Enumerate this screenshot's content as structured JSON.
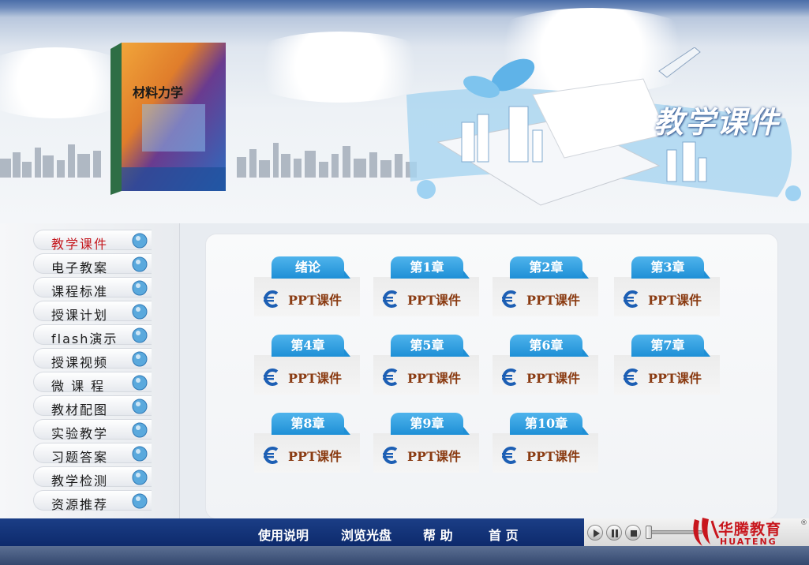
{
  "banner": {
    "title": "教学课件",
    "book_title": "材料力学"
  },
  "sidebar": {
    "items": [
      {
        "label": "教学课件",
        "icon": "projector-icon",
        "active": true
      },
      {
        "label": "电子教案",
        "icon": "info-icon",
        "active": false
      },
      {
        "label": "课程标准",
        "icon": "news-icon",
        "active": false
      },
      {
        "label": "授课计划",
        "icon": "globe-icon",
        "active": false
      },
      {
        "label": "flash演示",
        "icon": "magnifier-icon",
        "active": false
      },
      {
        "label": "授课视频",
        "icon": "clapperboard-icon",
        "active": false
      },
      {
        "label": "微 课 程",
        "icon": "monitor-icon",
        "active": false
      },
      {
        "label": "教材配图",
        "icon": "picture-icon",
        "active": false
      },
      {
        "label": "实验教学",
        "icon": "envelope-icon",
        "active": false
      },
      {
        "label": "习题答案",
        "icon": "ie-icon",
        "active": false
      },
      {
        "label": "教学检测",
        "icon": "open-book-icon",
        "active": false
      },
      {
        "label": "资源推荐",
        "icon": "chart-icon",
        "active": false
      }
    ]
  },
  "main": {
    "chapters": [
      {
        "title": "绪论",
        "link": "PPT课件"
      },
      {
        "title": "第1章",
        "link": "PPT课件"
      },
      {
        "title": "第2章",
        "link": "PPT课件"
      },
      {
        "title": "第3章",
        "link": "PPT课件"
      },
      {
        "title": "第4章",
        "link": "PPT课件"
      },
      {
        "title": "第5章",
        "link": "PPT课件"
      },
      {
        "title": "第6章",
        "link": "PPT课件"
      },
      {
        "title": "第7章",
        "link": "PPT课件"
      },
      {
        "title": "第8章",
        "link": "PPT课件"
      },
      {
        "title": "第9章",
        "link": "PPT课件"
      },
      {
        "title": "第10章",
        "link": "PPT课件"
      }
    ]
  },
  "bottom": {
    "links": [
      "使用说明",
      "浏览光盘",
      "帮  助",
      "首  页"
    ]
  },
  "logo": {
    "cn": "华腾教育",
    "en": "HUATENG",
    "reg": "®"
  },
  "colors": {
    "accent_blue": "#1e8fd6",
    "nav_bar": "#0d2a6c",
    "active_red": "#c4161c",
    "ppt_brown": "#8a3b12"
  }
}
